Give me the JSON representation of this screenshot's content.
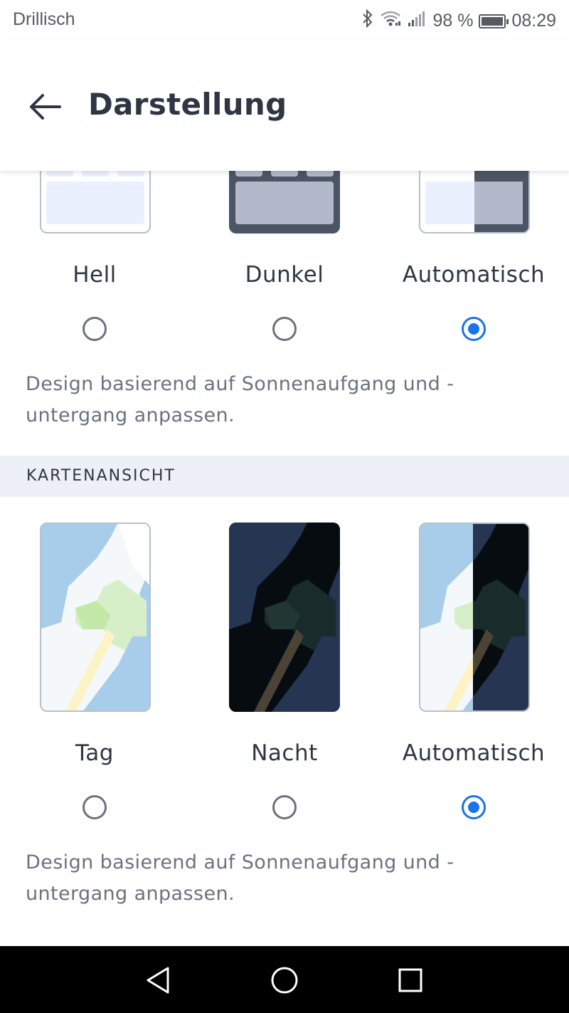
{
  "status_bar": {
    "carrier": "Drillisch",
    "battery": "98 %",
    "time": "08:29",
    "icons": [
      "bluetooth-icon",
      "wifi-icon",
      "signal-icon",
      "battery-icon"
    ]
  },
  "app_bar": {
    "title": "Darstellung",
    "back_icon": "arrow-left-icon"
  },
  "theme": {
    "options": [
      {
        "label": "Hell",
        "selected": false
      },
      {
        "label": "Dunkel",
        "selected": false
      },
      {
        "label": "Automatisch",
        "selected": true
      }
    ],
    "description": "Design basierend auf Sonnenaufgang und -untergang anpassen."
  },
  "map_view": {
    "header": "KARTENANSICHT",
    "options": [
      {
        "label": "Tag",
        "selected": false
      },
      {
        "label": "Nacht",
        "selected": false
      },
      {
        "label": "Automatisch",
        "selected": true
      }
    ],
    "description": "Design basierend auf Sonnenaufgang und -untergang anpassen."
  },
  "colors": {
    "accent": "#1a73e8",
    "text_primary": "#2e3644",
    "text_secondary": "#6b7280",
    "section_bg": "#edf1f7"
  },
  "nav_bar": {
    "icons": [
      "back-triangle-icon",
      "home-circle-icon",
      "recents-square-icon"
    ]
  }
}
